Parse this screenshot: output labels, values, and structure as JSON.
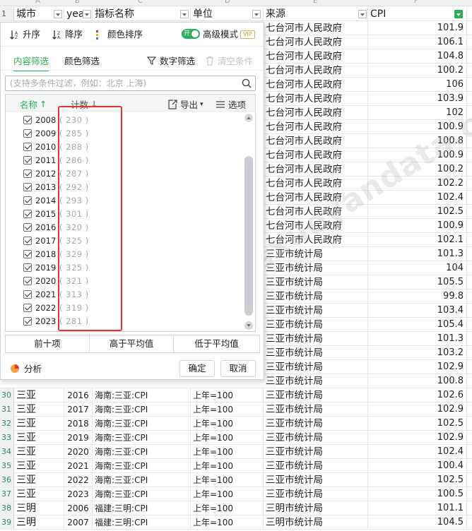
{
  "colors": {
    "accent": "#2bae55",
    "highlight": "#e8322b",
    "filter_active": "#2bae55"
  },
  "col_letters": [
    "A",
    "B",
    "C",
    "D",
    "E",
    "F"
  ],
  "header_row": {
    "row_num": "1",
    "city": "城市",
    "year": "yea",
    "indicator": "指标名称",
    "unit": "单位",
    "source": "来源",
    "cpi": "CPI"
  },
  "visible_rows": [
    {
      "src": "七台河市人民政府",
      "cpi": "101.9"
    },
    {
      "src": "七台河市人民政府",
      "cpi": "106.1"
    },
    {
      "src": "七台河市人民政府",
      "cpi": "104.8"
    },
    {
      "src": "七台河市人民政府",
      "cpi": "100.2"
    },
    {
      "src": "七台河市人民政府",
      "cpi": "106"
    },
    {
      "src": "七台河市人民政府",
      "cpi": "103.9"
    },
    {
      "src": "七台河市人民政府",
      "cpi": "102"
    },
    {
      "src": "七台河市人民政府",
      "cpi": "100.9"
    },
    {
      "src": "七台河市人民政府",
      "cpi": "100.8"
    },
    {
      "src": "七台河市人民政府",
      "cpi": "100.9"
    },
    {
      "src": "七台河市人民政府",
      "cpi": "100.2"
    },
    {
      "src": "七台河市人民政府",
      "cpi": "102.2"
    },
    {
      "src": "七台河市人民政府",
      "cpi": "102.4"
    },
    {
      "src": "七台河市人民政府",
      "cpi": "102.5"
    },
    {
      "src": "七台河市人民政府",
      "cpi": "100.9"
    },
    {
      "src": "七台河市人民政府",
      "cpi": "102.1"
    },
    {
      "src": "三亚市统计局",
      "cpi": "101.3"
    },
    {
      "src": "三亚市统计局",
      "cpi": "104"
    },
    {
      "src": "三亚市统计局",
      "cpi": "105.5"
    },
    {
      "src": "三亚市统计局",
      "cpi": "99.8"
    },
    {
      "src": "三亚市统计局",
      "cpi": "103.4"
    },
    {
      "src": "三亚市统计局",
      "cpi": "105.4"
    },
    {
      "src": "三亚市统计局",
      "cpi": "101.3"
    },
    {
      "src": "三亚市统计局",
      "cpi": "103.2"
    },
    {
      "src": "三亚市统计局",
      "cpi": "102.9"
    },
    {
      "src": "三亚市统计局",
      "cpi": "100.8"
    }
  ],
  "full_rows": [
    {
      "rn": "30",
      "city": "三亚",
      "year": "2016",
      "ind": "海南:三亚:CPI",
      "unit": "上年=100",
      "src": "三亚市统计局",
      "cpi": "102.6"
    },
    {
      "rn": "31",
      "city": "三亚",
      "year": "2017",
      "ind": "海南:三亚:CPI",
      "unit": "上年=100",
      "src": "三亚市统计局",
      "cpi": "102.9"
    },
    {
      "rn": "32",
      "city": "三亚",
      "year": "2018",
      "ind": "海南:三亚:CPI",
      "unit": "上年=100",
      "src": "三亚市统计局",
      "cpi": "102.5"
    },
    {
      "rn": "33",
      "city": "三亚",
      "year": "2019",
      "ind": "海南:三亚:CPI",
      "unit": "上年=100",
      "src": "三亚市统计局",
      "cpi": "102.9"
    },
    {
      "rn": "34",
      "city": "三亚",
      "year": "2020",
      "ind": "海南:三亚:CPI",
      "unit": "上年=100",
      "src": "三亚市统计局",
      "cpi": "102.4"
    },
    {
      "rn": "35",
      "city": "三亚",
      "year": "2021",
      "ind": "海南:三亚:CPI",
      "unit": "上年=100",
      "src": "三亚市统计局",
      "cpi": "100.4"
    },
    {
      "rn": "36",
      "city": "三亚",
      "year": "2022",
      "ind": "海南:三亚:CPI",
      "unit": "上年=100",
      "src": "三亚市统计局",
      "cpi": "102.5"
    },
    {
      "rn": "37",
      "city": "三亚",
      "year": "2023",
      "ind": "海南:三亚:CPI",
      "unit": "上年=100",
      "src": "三亚市统计局",
      "cpi": "100.5"
    },
    {
      "rn": "38",
      "city": "三明",
      "year": "2006",
      "ind": "福建:三明:CPI",
      "unit": "上年=100",
      "src": "三明市统计局",
      "cpi": "101.1"
    },
    {
      "rn": "39",
      "city": "三明",
      "year": "2007",
      "ind": "福建:三明:CPI",
      "unit": "上年=100",
      "src": "三明市统计局",
      "cpi": "104.5"
    }
  ],
  "watermark": "更多数据xueyandata.com",
  "filter_panel": {
    "sort_asc": "升序",
    "sort_desc": "降序",
    "color_sort": "颜色排序",
    "toggle_label": "开",
    "advanced_mode": "高级模式",
    "vip": "VIP",
    "tab_content": "内容筛选",
    "tab_color": "颜色筛选",
    "number_filter": "数字筛选",
    "clear_conditions": "清空条件",
    "search_placeholder": "(支持多条件过滤，例如：北京 上海)",
    "col_name": "名称",
    "col_count": "计数",
    "export": "导出",
    "options": "选项",
    "items": [
      {
        "label": "2008",
        "count": "( 230 )"
      },
      {
        "label": "2009",
        "count": "( 285 )"
      },
      {
        "label": "2010",
        "count": "( 288 )"
      },
      {
        "label": "2011",
        "count": "( 286 )"
      },
      {
        "label": "2012",
        "count": "( 287 )"
      },
      {
        "label": "2013",
        "count": "( 292 )"
      },
      {
        "label": "2014",
        "count": "( 293 )"
      },
      {
        "label": "2015",
        "count": "( 301 )"
      },
      {
        "label": "2016",
        "count": "( 320 )"
      },
      {
        "label": "2017",
        "count": "( 325 )"
      },
      {
        "label": "2018",
        "count": "( 329 )"
      },
      {
        "label": "2019",
        "count": "( 325 )"
      },
      {
        "label": "2020",
        "count": "( 321 )"
      },
      {
        "label": "2021",
        "count": "( 313 )"
      },
      {
        "label": "2022",
        "count": "( 319 )"
      },
      {
        "label": "2023",
        "count": "( 281 )"
      }
    ],
    "top_ten": "前十项",
    "above_avg": "高于平均值",
    "below_avg": "低于平均值",
    "analysis": "分析",
    "ok": "确定",
    "cancel": "取消"
  }
}
